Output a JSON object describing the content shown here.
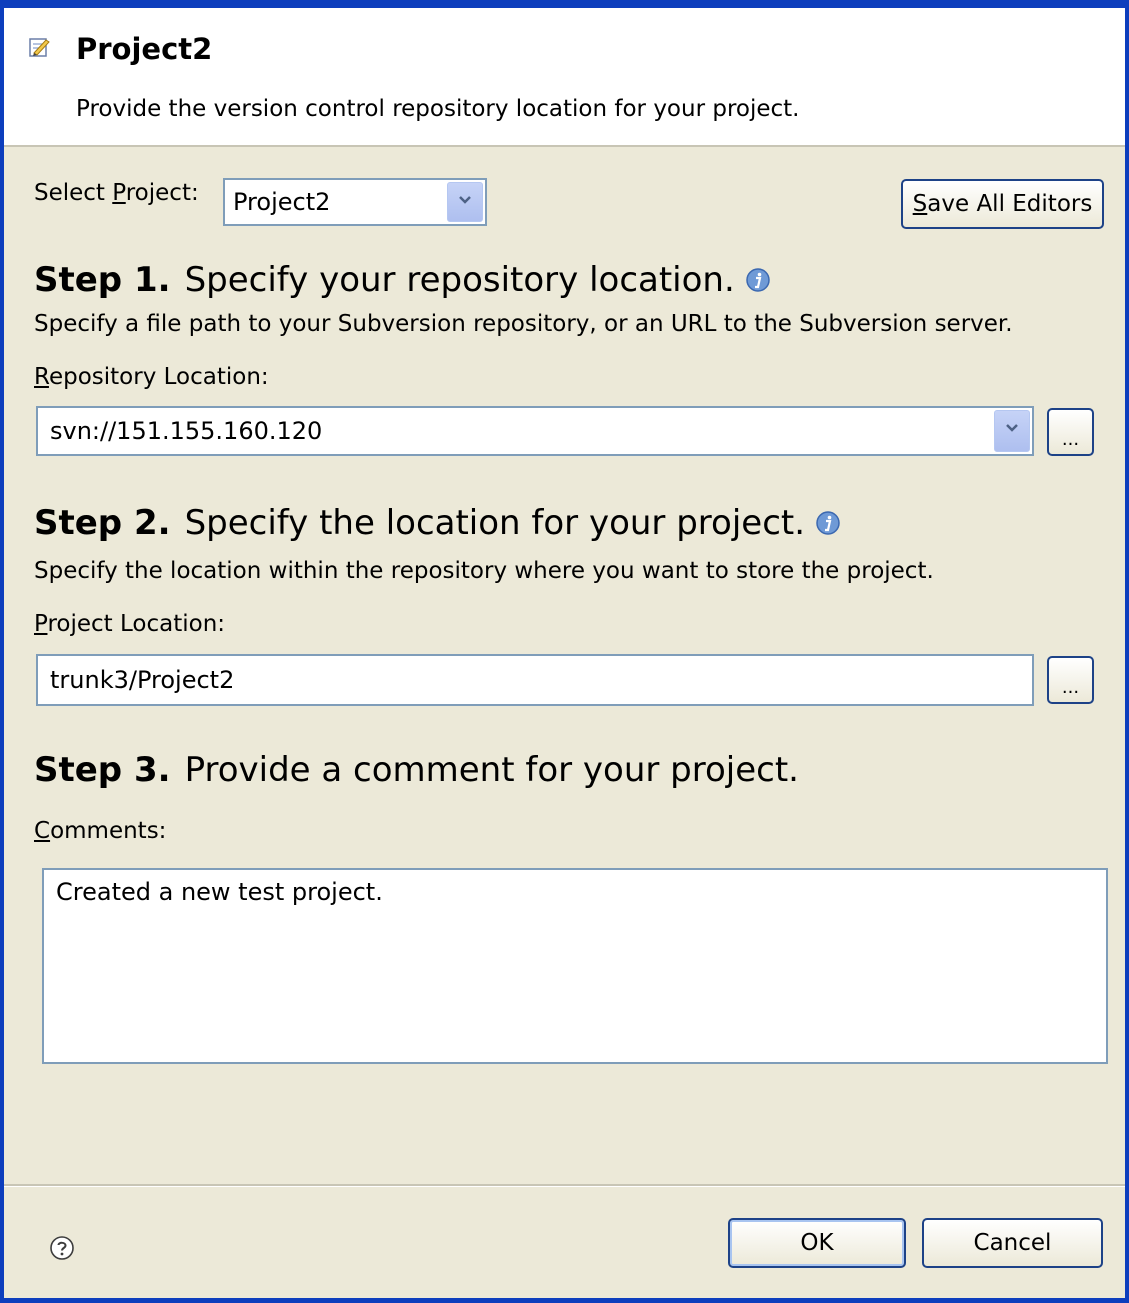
{
  "dialog": {
    "title": "Project2",
    "subtitle": "Provide the version control repository location for your project."
  },
  "select_project": {
    "label_prefix": "Select ",
    "label_mnemonic": "P",
    "label_suffix": "roject:",
    "value": "Project2"
  },
  "save_all": {
    "label_mnemonic": "S",
    "label_rest": "ave All Editors"
  },
  "step1": {
    "number": "Step 1.",
    "heading": "Specify your repository location.",
    "description": "Specify a file path to your Subversion repository, or an URL to the Subversion server.",
    "field_label_mnemonic": "R",
    "field_label_rest": "epository Location:",
    "value": "svn://151.155.160.120",
    "browse_label": "..."
  },
  "step2": {
    "number": "Step 2.",
    "heading": "Specify the location for your project.",
    "description": "Specify the location within the repository where you want to store the project.",
    "field_label_mnemonic": "P",
    "field_label_rest": "roject Location:",
    "value": "trunk3/Project2",
    "browse_label": "..."
  },
  "step3": {
    "number": "Step 3.",
    "heading": "Provide a comment for your project.",
    "field_label_mnemonic": "C",
    "field_label_rest": "omments:",
    "value": "Created a new test project."
  },
  "footer": {
    "ok_label": "OK",
    "cancel_label": "Cancel"
  },
  "icons": {
    "header": "wizard-icon",
    "info": "info-icon",
    "help": "help-icon",
    "dropdown": "chevron-down-icon"
  },
  "colors": {
    "window_border": "#0d3ebd",
    "dialog_bg": "#ece9d8",
    "field_border": "#7f9db9",
    "button_border": "#1d4287"
  }
}
